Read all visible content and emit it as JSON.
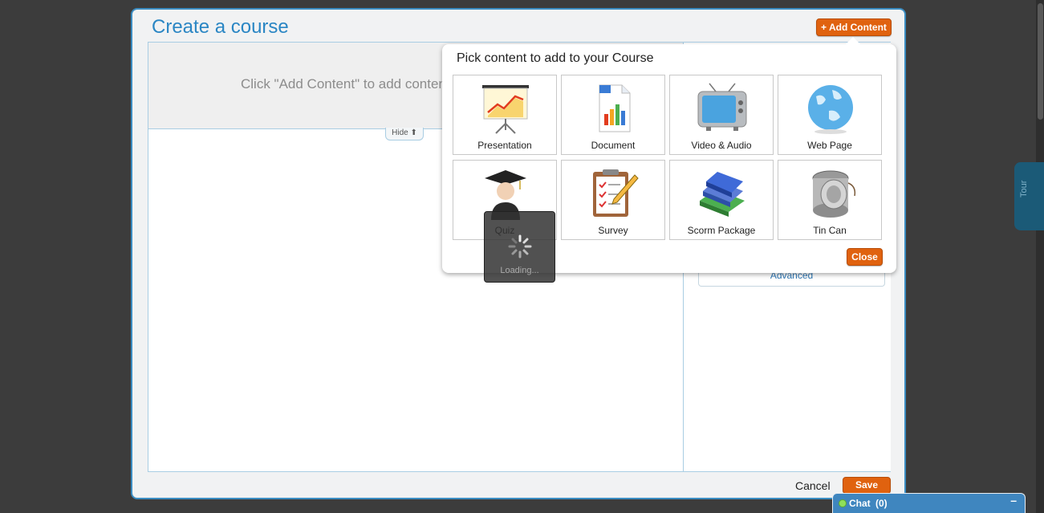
{
  "dialog": {
    "title": "Create a course",
    "add_content_label": "+ Add Content",
    "banner_text": "Click \"Add Content\" to add content",
    "hide_label": "Hide",
    "advanced_label": "Advanced",
    "cancel_label": "Cancel",
    "save_label": "Save"
  },
  "picker": {
    "title": "Pick content to add to your Course",
    "tiles": [
      {
        "label": "Presentation",
        "icon": "presentation-icon"
      },
      {
        "label": "Document",
        "icon": "document-icon"
      },
      {
        "label": "Video & Audio",
        "icon": "tv-icon"
      },
      {
        "label": "Web Page",
        "icon": "globe-icon"
      },
      {
        "label": "Quiz",
        "icon": "graduate-icon"
      },
      {
        "label": "Survey",
        "icon": "clipboard-icon"
      },
      {
        "label": "Scorm Package",
        "icon": "books-icon"
      },
      {
        "label": "Tin Can",
        "icon": "tin-can-icon"
      }
    ],
    "close_label": "Close"
  },
  "loading": {
    "text": "Loading..."
  },
  "side_tab": {
    "label": "Tour"
  },
  "chat": {
    "label": "Chat",
    "count": "(0)",
    "minimize": "–"
  },
  "colors": {
    "accent_blue": "#2a86c4",
    "button_orange": "#e0620f",
    "chat_blue": "#3f86bf"
  }
}
